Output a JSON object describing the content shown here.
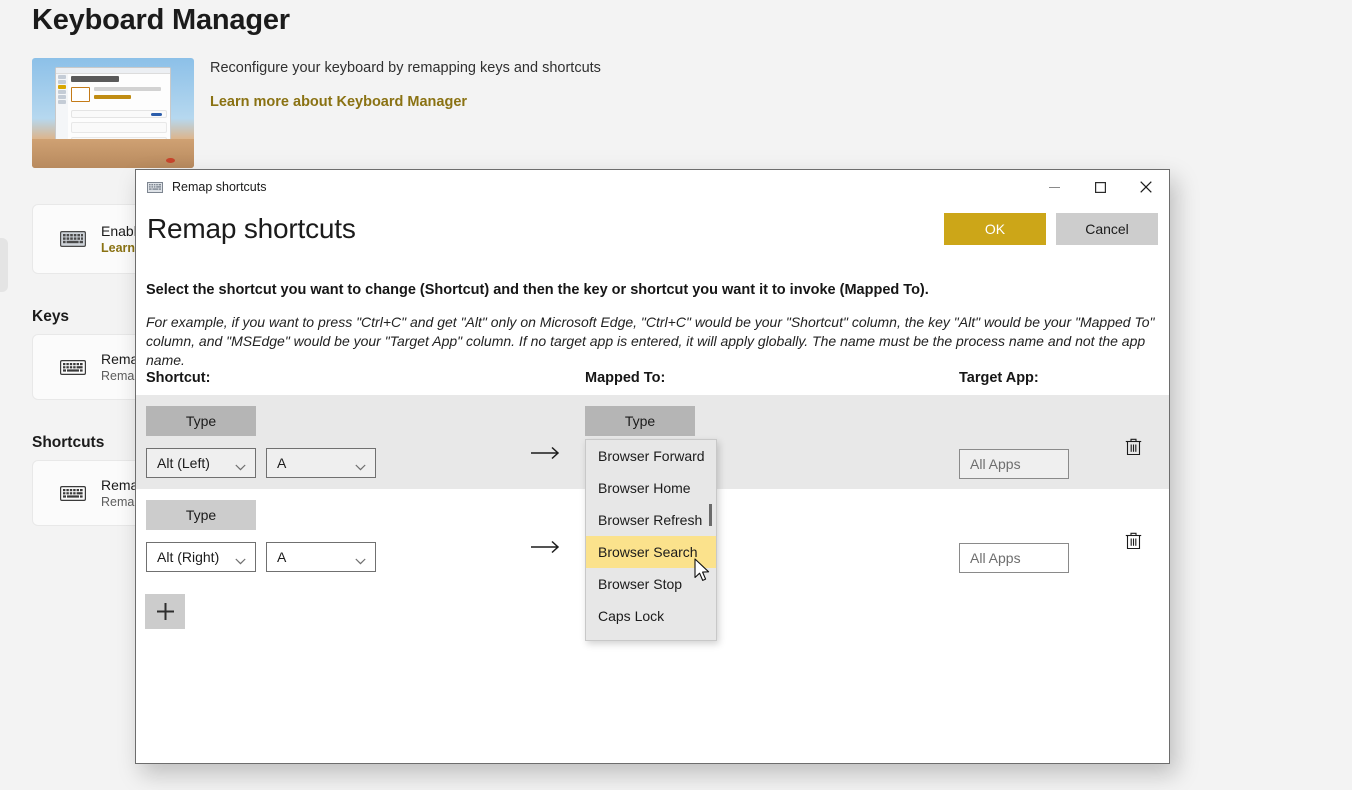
{
  "page": {
    "title": "Keyboard Manager",
    "hero": {
      "description": "Reconfigure your keyboard by remapping keys and shortcuts",
      "link": "Learn more about Keyboard Manager"
    },
    "cards": [
      {
        "title": "Enable Keyboard Manager",
        "sub": "Learn more",
        "icon": "keyboard-icon"
      },
      {
        "title": "Remap a key",
        "sub": "Remap keys to other keys or shortcuts",
        "icon": "keyboard-icon"
      },
      {
        "title": "Remap a shortcut",
        "sub": "Remap shortcuts to other keys or shortcuts",
        "icon": "keyboard-icon"
      }
    ],
    "sections": {
      "keys": "Keys",
      "shortcuts": "Shortcuts"
    }
  },
  "dialog": {
    "titlebar": {
      "icon": "keyboard-icon",
      "title": "Remap shortcuts",
      "minimize": "—",
      "maximize": "☐",
      "close": "✕"
    },
    "heading": "Remap shortcuts",
    "ok_label": "OK",
    "cancel_label": "Cancel",
    "description_1": "Select the shortcut you want to change (Shortcut) and then the key or shortcut you want it to invoke (Mapped To).",
    "description_2": "For example, if you want to press \"Ctrl+C\" and get \"Alt\" only on Microsoft Edge, \"Ctrl+C\" would be your \"Shortcut\" column, the key \"Alt\" would be your \"Mapped To\" column, and \"MSEdge\" would be your \"Target App\" column. If no target app is entered, it will apply globally. The name must be the process name and not the app name.",
    "columns": {
      "shortcut": "Shortcut:",
      "mapped_to": "Mapped To:",
      "target_app": "Target App:"
    },
    "rows": [
      {
        "type_label": "Type",
        "modifier": "Alt (Left)",
        "key": "A",
        "arrow": "→",
        "mapped_type_label": "Type",
        "target_app_placeholder": "All Apps",
        "delete_icon": "trash-icon"
      },
      {
        "type_label": "Type",
        "modifier": "Alt (Right)",
        "key": "A",
        "arrow": "→",
        "target_app_placeholder": "All Apps",
        "delete_icon": "trash-icon"
      }
    ],
    "add_label": "+",
    "dropdown": {
      "items": [
        "Browser Forward",
        "Browser Home",
        "Browser Refresh",
        "Browser Search",
        "Browser Stop",
        "Caps Lock"
      ],
      "selected": "Browser Search"
    }
  },
  "colors": {
    "accent_ok": "#cca618",
    "link": "#8a7213",
    "highlight": "#fbe28c",
    "row_hover": "#e8e8e8"
  }
}
